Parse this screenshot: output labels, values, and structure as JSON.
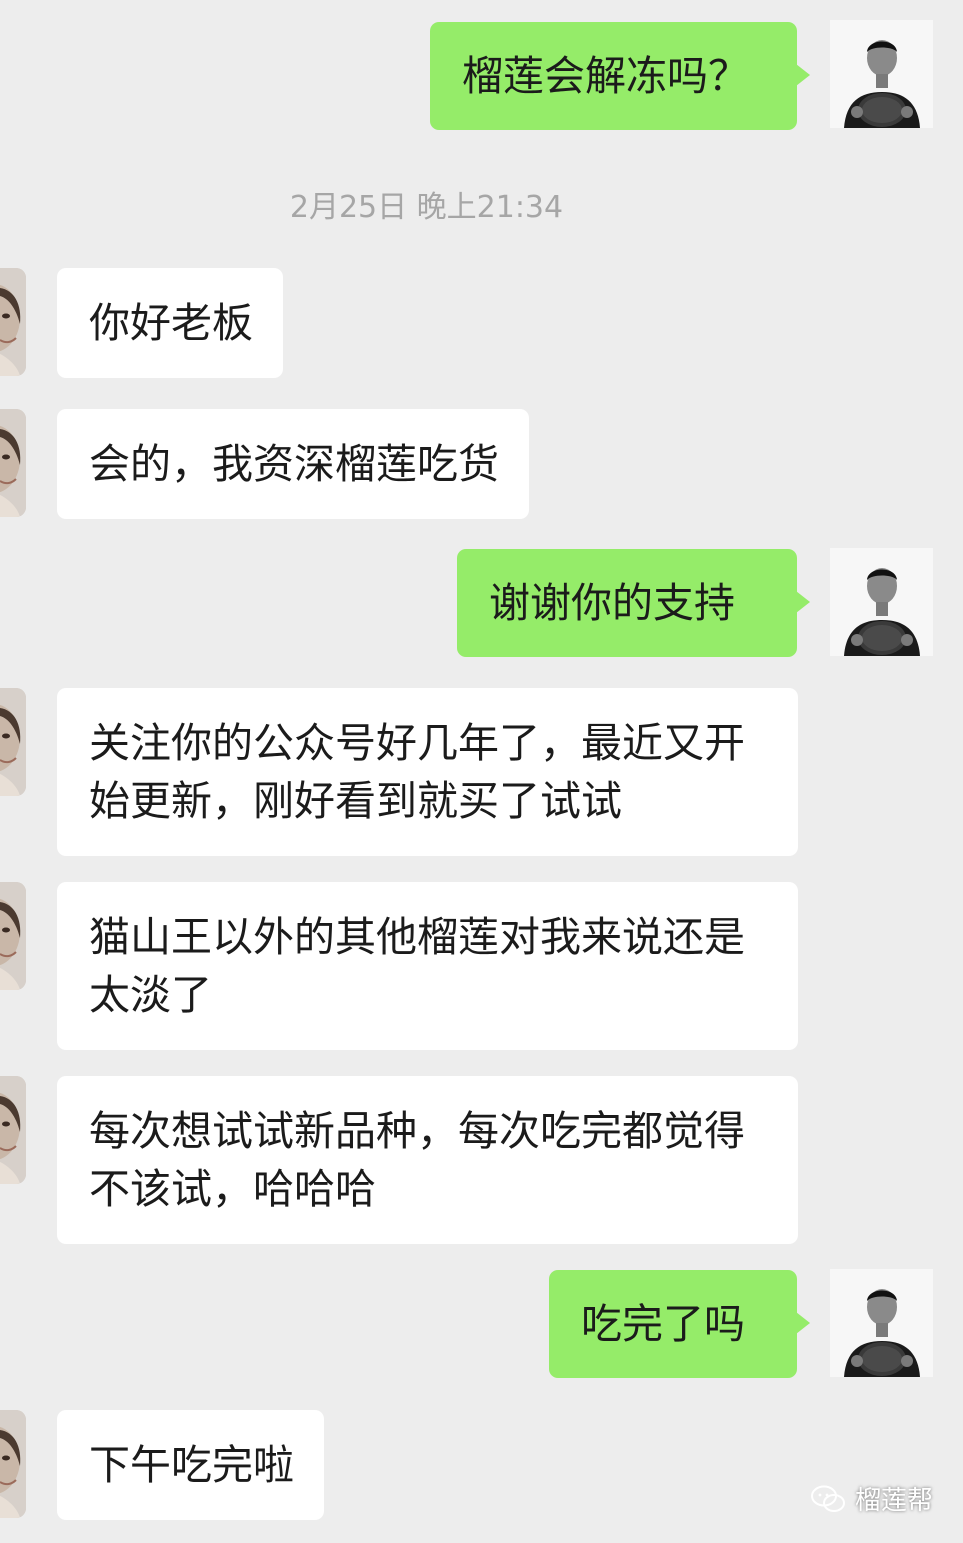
{
  "timestamp": "2月25日 晚上21:34",
  "messages": [
    {
      "side": "out",
      "text": "榴莲会解冻吗？"
    },
    {
      "side": "in",
      "text": "你好老板"
    },
    {
      "side": "in",
      "text": "会的，我资深榴莲吃货"
    },
    {
      "side": "out",
      "text": "谢谢你的支持"
    },
    {
      "side": "in",
      "text": "关注你的公众号好几年了，最近又开始更新，刚好看到就买了试试"
    },
    {
      "side": "in",
      "text": "猫山王以外的其他榴莲对我来说还是太淡了"
    },
    {
      "side": "in",
      "text": "每次想试试新品种，每次吃完都觉得不该试，哈哈哈"
    },
    {
      "side": "out",
      "text": "吃完了吗"
    },
    {
      "side": "in",
      "text": "下午吃完啦"
    }
  ],
  "watermark": {
    "icon": "wechat-icon",
    "label": "榴莲帮"
  },
  "colors": {
    "background": "#ededed",
    "outgoing_bubble": "#95ec69",
    "incoming_bubble": "#ffffff",
    "timestamp_text": "#a6a6a6"
  }
}
